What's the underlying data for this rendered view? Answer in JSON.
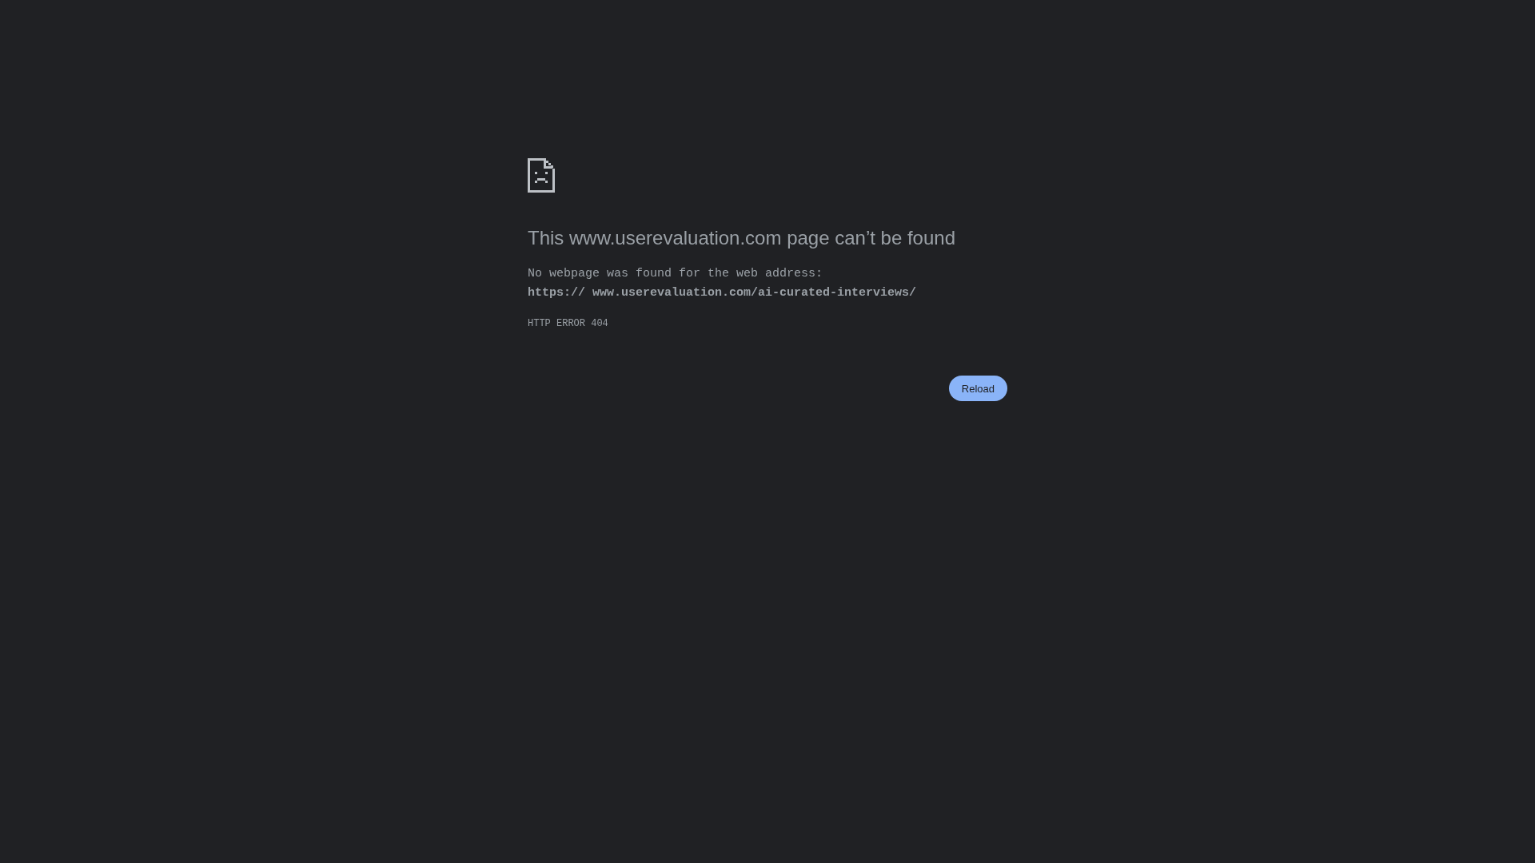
{
  "error_page": {
    "title": "This www.userevaluation.com page can’t be found",
    "description": "No webpage was found for the web address:",
    "url": "https:// www.userevaluation.com/ai-curated-interviews/",
    "error_code": "HTTP ERROR 404"
  },
  "buttons": [
    {
      "label": "Reload"
    }
  ]
}
